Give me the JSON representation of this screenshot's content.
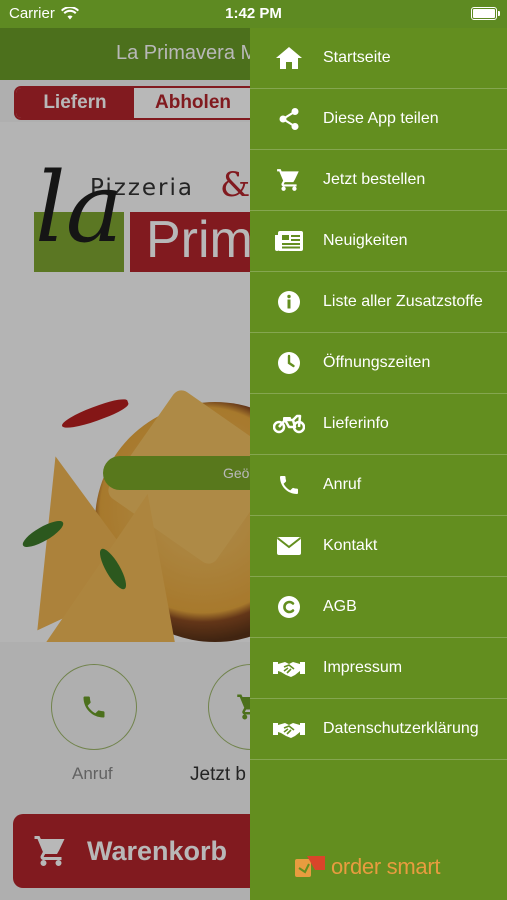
{
  "status_bar": {
    "carrier": "Carrier",
    "time": "1:42 PM"
  },
  "header": {
    "title": "La Primavera M"
  },
  "order_mode": {
    "deliver_label": "Liefern",
    "pickup_label": "Abholen",
    "selected": "Liefern"
  },
  "logo": {
    "line1": "Pizzeria",
    "amp": "&",
    "la": "la",
    "prim": "Prim"
  },
  "geo_button": {
    "label": "Geö"
  },
  "quick_actions": [
    {
      "label": "Anruf",
      "icon": "phone-icon"
    },
    {
      "label": "Jetzt b",
      "icon": "cart-icon"
    }
  ],
  "cart_button": {
    "label": "Warenkorb",
    "icon": "cart-icon"
  },
  "menu": {
    "items": [
      {
        "label": "Startseite",
        "icon": "home-icon"
      },
      {
        "label": "Diese App teilen",
        "icon": "share-icon"
      },
      {
        "label": "Jetzt bestellen",
        "icon": "cart-icon"
      },
      {
        "label": "Neuigkeiten",
        "icon": "news-icon"
      },
      {
        "label": "Liste aller Zusatzstoffe",
        "icon": "info-icon"
      },
      {
        "label": "Öffnungszeiten",
        "icon": "clock-icon"
      },
      {
        "label": "Lieferinfo",
        "icon": "motorcycle-icon"
      },
      {
        "label": "Anruf",
        "icon": "phone-icon"
      },
      {
        "label": "Kontakt",
        "icon": "envelope-icon"
      },
      {
        "label": "AGB",
        "icon": "copyright-icon"
      },
      {
        "label": "Impressum",
        "icon": "handshake-icon"
      },
      {
        "label": "Datenschutzerklärung",
        "icon": "handshake-icon"
      }
    ]
  },
  "brand": {
    "text": "order smart",
    "color": "#e89c3f"
  },
  "colors": {
    "green": "#638e1f",
    "red": "#b3242c"
  }
}
